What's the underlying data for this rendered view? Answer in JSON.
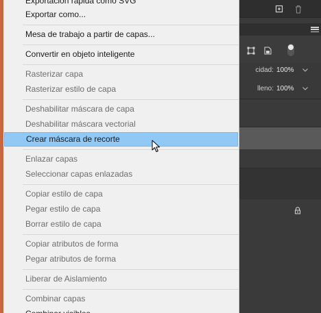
{
  "menu": {
    "items": [
      {
        "label": "Exportación rápida como SVG",
        "enabled": true
      },
      {
        "label": "Exportar como...",
        "enabled": true
      },
      {
        "label": "Mesa de trabajo a partir de capas...",
        "enabled": true
      },
      {
        "label": "Convertir en objeto inteligente",
        "enabled": true
      },
      {
        "label": "Rasterizar capa",
        "enabled": false
      },
      {
        "label": "Rasterizar estilo de capa",
        "enabled": false
      },
      {
        "label": "Deshabilitar máscara de capa",
        "enabled": false
      },
      {
        "label": "Deshabilitar máscara vectorial",
        "enabled": false
      },
      {
        "label": "Crear máscara de recorte",
        "enabled": true,
        "highlighted": true
      },
      {
        "label": "Enlazar capas",
        "enabled": false
      },
      {
        "label": "Seleccionar capas enlazadas",
        "enabled": false
      },
      {
        "label": "Copiar estilo de capa",
        "enabled": false
      },
      {
        "label": "Pegar estilo de capa",
        "enabled": false
      },
      {
        "label": "Borrar estilo de capa",
        "enabled": false
      },
      {
        "label": "Copiar atributos de forma",
        "enabled": false
      },
      {
        "label": "Pegar atributos de forma",
        "enabled": false
      },
      {
        "label": "Liberar de Aislamiento",
        "enabled": false
      },
      {
        "label": "Combinar capas",
        "enabled": false
      },
      {
        "label": "Combinar visibles",
        "enabled": true
      }
    ]
  },
  "layers_panel": {
    "opacity_label": "cidad:",
    "opacity_value": "100%",
    "fill_label": "lleno:",
    "fill_value": "100%"
  },
  "colors": {
    "highlight": "#90c8f6",
    "menu_bg": "#f0f0f0",
    "panel_bg": "#393939",
    "accent_strip": "#c9683f"
  }
}
